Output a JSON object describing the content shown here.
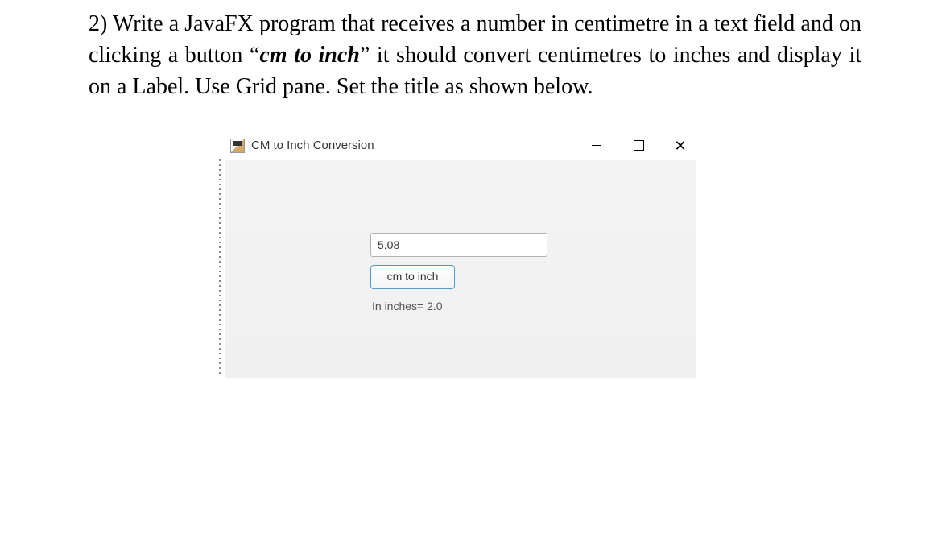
{
  "question": {
    "number": "2)",
    "text_part1": "Write a JavaFX program that receives a number in centimetre in a text field and on clicking a button ",
    "quote_open": "“",
    "emphasis": "cm to inch",
    "quote_close": "”",
    "text_part2": " it should convert centimetres to inches and display it on a Label. Use Grid pane. Set the title as shown below."
  },
  "window": {
    "title": "CM to Inch Conversion",
    "input_value": "5.08",
    "button_label": "cm to inch",
    "result_text": "In inches= 2.0"
  }
}
